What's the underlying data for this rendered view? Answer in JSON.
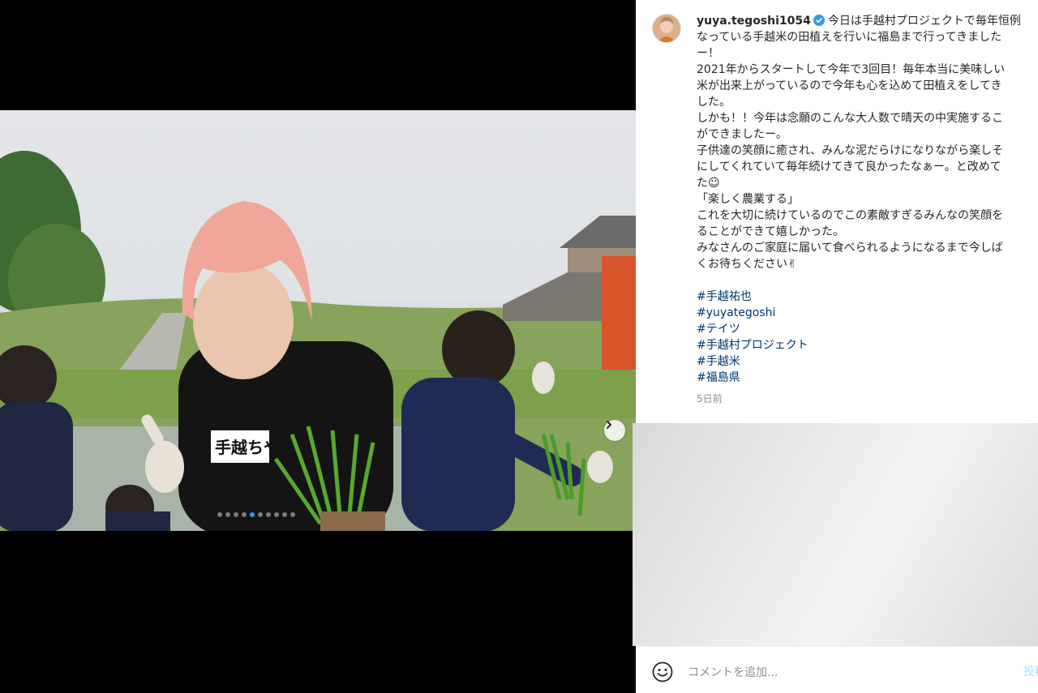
{
  "post": {
    "username": "yuya.tegoshi1054",
    "caption_lines": [
      "今日は手越村プロジェクトで毎年恒例",
      "なっている手越米の田植えを行いに福島まで行ってきました",
      "ー！",
      "2021年からスタートして今年で3回目！毎年本当に美味しい",
      "米が出来上がっているので今年も心を込めて田植えをしてき",
      "した。",
      "しかも！！今年は念願のこんな大人数で晴天の中実施するこ",
      "ができましたー。",
      "子供達の笑顔に癒され、みんな泥だらけになりながら楽しそ",
      "にしてくれていて毎年続けてきて良かったなぁー。と改めて",
      "た☺",
      "「楽しく農業する」",
      "これを大切に続けているのでこの素敵すぎるみんなの笑顔を",
      "ることができて嬉しかった。",
      "みなさんのご家庭に届いて食べられるようになるまで今しば",
      "くお待ちください✌"
    ],
    "hashtags": [
      "#手越祐也",
      "#yuyategoshi",
      "#テイツ",
      "#手越村プロジェクト",
      "#手越米",
      "#福島県"
    ],
    "time_ago": "5日前",
    "photo_shirt_text": "手越ちや"
  },
  "carousel": {
    "count": 10,
    "active_index": 4
  },
  "comment": {
    "placeholder": "コメントを追加...",
    "post_label": "投稿"
  },
  "colors": {
    "link": "#00376b",
    "verified": "#3897f0",
    "muted": "#8e8e8e",
    "dot_active": "#3f93f1"
  },
  "icons": {
    "next": "chevron-right-icon",
    "verified": "verified-badge-icon",
    "emoji": "emoji-icon"
  }
}
